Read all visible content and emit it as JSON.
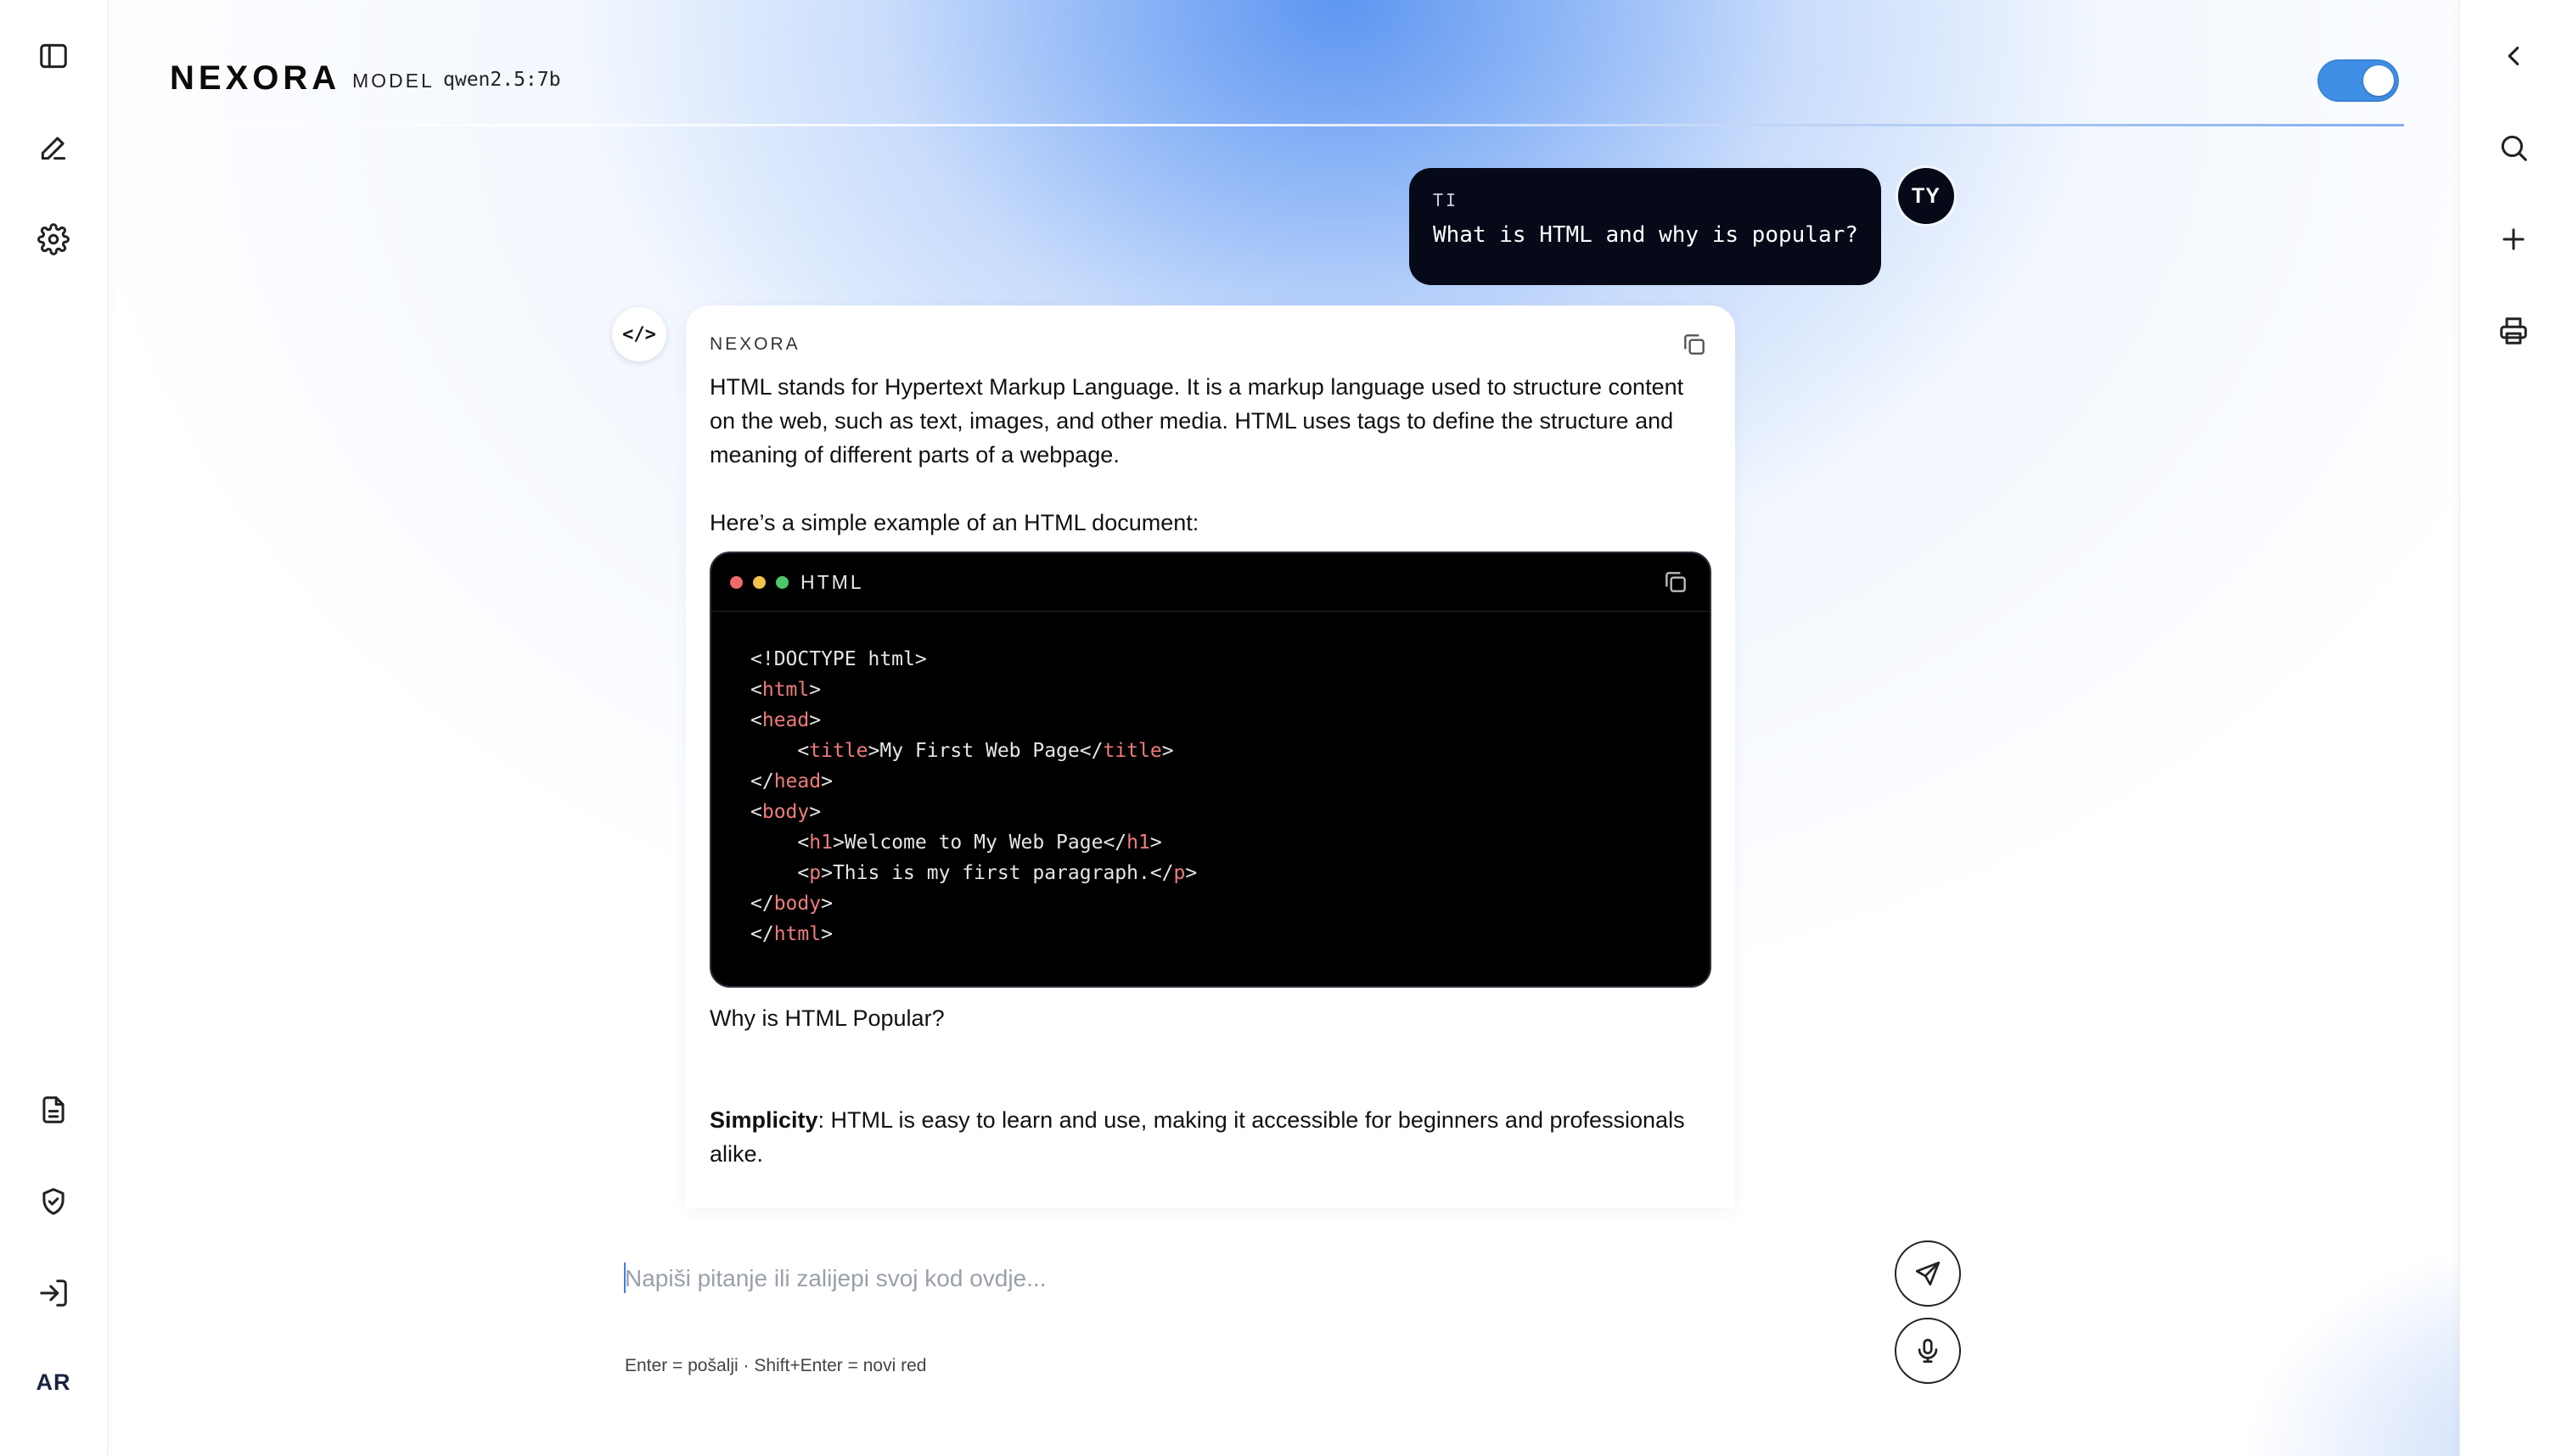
{
  "header": {
    "brand": "NEXORA",
    "model_label": "MODEL",
    "model_name": "qwen2.5:7b"
  },
  "sidebar_left": {
    "items": [
      {
        "icon": "sidebar-toggle-icon"
      },
      {
        "icon": "edit-icon"
      },
      {
        "icon": "gear-icon"
      },
      {
        "icon": "document-icon"
      },
      {
        "icon": "shield-icon"
      },
      {
        "icon": "login-icon"
      }
    ],
    "language": "AR"
  },
  "sidebar_right": {
    "items": [
      {
        "icon": "chevron-left-icon"
      },
      {
        "icon": "search-icon"
      },
      {
        "icon": "plus-icon"
      },
      {
        "icon": "printer-icon"
      }
    ]
  },
  "toggle": {
    "state": "on",
    "color": "#3f8fe6"
  },
  "user_message": {
    "sender": "TI",
    "text": "What is HTML and why is popular?",
    "avatar": "TY"
  },
  "assistant_message": {
    "avatar_glyph": "</>",
    "sender": "NEXORA",
    "paragraph1": "HTML stands for Hypertext Markup Language. It is a markup language used to structure content on the web, such as text, images, and other media. HTML uses tags to define the structure and meaning of different parts of a webpage.",
    "paragraph2": "Here’s a simple example of an HTML document:",
    "code": {
      "language": "HTML",
      "lines": [
        {
          "indent": 0,
          "parts": [
            [
              "p",
              "<!DOCTYPE html>"
            ]
          ]
        },
        {
          "indent": 0,
          "parts": [
            [
              "p",
              "<"
            ],
            [
              "t",
              "html"
            ],
            [
              "p",
              ">"
            ]
          ]
        },
        {
          "indent": 0,
          "parts": [
            [
              "p",
              "<"
            ],
            [
              "t",
              "head"
            ],
            [
              "p",
              ">"
            ]
          ]
        },
        {
          "indent": 1,
          "parts": [
            [
              "p",
              "<"
            ],
            [
              "t",
              "title"
            ],
            [
              "p",
              ">My First Web Page</"
            ],
            [
              "t",
              "title"
            ],
            [
              "p",
              ">"
            ]
          ]
        },
        {
          "indent": 0,
          "parts": [
            [
              "p",
              "</"
            ],
            [
              "t",
              "head"
            ],
            [
              "p",
              ">"
            ]
          ]
        },
        {
          "indent": 0,
          "parts": [
            [
              "p",
              "<"
            ],
            [
              "t",
              "body"
            ],
            [
              "p",
              ">"
            ]
          ]
        },
        {
          "indent": 1,
          "parts": [
            [
              "p",
              "<"
            ],
            [
              "t",
              "h1"
            ],
            [
              "p",
              ">Welcome to My Web Page</"
            ],
            [
              "t",
              "h1"
            ],
            [
              "p",
              ">"
            ]
          ]
        },
        {
          "indent": 1,
          "parts": [
            [
              "p",
              "<"
            ],
            [
              "t",
              "p"
            ],
            [
              "p",
              ">This is my first paragraph.</"
            ],
            [
              "t",
              "p"
            ],
            [
              "p",
              ">"
            ]
          ]
        },
        {
          "indent": 0,
          "parts": [
            [
              "p",
              "</"
            ],
            [
              "t",
              "body"
            ],
            [
              "p",
              ">"
            ]
          ]
        },
        {
          "indent": 0,
          "parts": [
            [
              "p",
              "</"
            ],
            [
              "t",
              "html"
            ],
            [
              "p",
              ">"
            ]
          ]
        }
      ]
    },
    "paragraph3": "Why is HTML Popular?",
    "paragraph4_bold": "Simplicity",
    "paragraph4_rest": ": HTML is easy to learn and use, making it accessible for beginners and professionals alike."
  },
  "composer": {
    "placeholder": "Napiši pitanje ili zalijepi svoj kod ovdje...",
    "value": "",
    "hint": "Enter = pošalji · Shift+Enter = novi red"
  },
  "colors": {
    "accent": "#3f8fe6",
    "dark_bubble": "#060a18",
    "code_tag": "#f07b7b",
    "dot_red": "#f06b6b",
    "dot_yellow": "#f3c24a",
    "dot_green": "#4cc86a"
  }
}
